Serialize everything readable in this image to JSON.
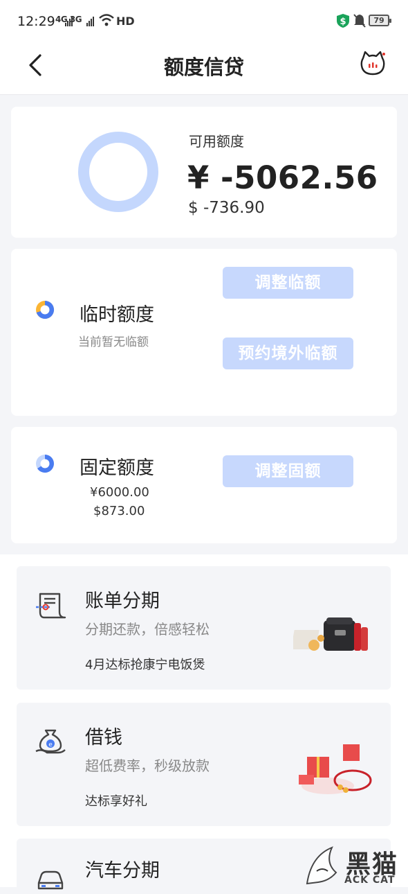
{
  "status_bar": {
    "time": "12:29",
    "network": "4G 3G",
    "hd": "HD",
    "battery": "79"
  },
  "nav": {
    "title": "额度信贷",
    "back_icon": "chevron-left-icon",
    "service_icon": "cat-service-icon"
  },
  "available": {
    "label": "可用额度",
    "cny": "¥ -5062.56",
    "usd": "$ -736.90",
    "ring_color": "#c4d7fd"
  },
  "temporary": {
    "title": "临时额度",
    "subtitle": "当前暂无临额",
    "adjust_button": "调整临额",
    "overseas_button": "预约境外临额"
  },
  "fixed": {
    "title": "固定额度",
    "cny": "¥6000.00",
    "usd": "$873.00",
    "adjust_button": "调整固额"
  },
  "services": [
    {
      "title": "账单分期",
      "desc": "分期还款，倍感轻松",
      "promo": "4月达标抢康宁电饭煲",
      "icon": "bill-installment-icon"
    },
    {
      "title": "借钱",
      "desc": "超低费率，秒级放款",
      "promo": "达标享好礼",
      "icon": "money-bag-icon"
    },
    {
      "title": "汽车分期",
      "icon": "car-icon"
    }
  ],
  "watermark": {
    "text": "黑猫",
    "sub": "ACK CAT"
  },
  "colors": {
    "accent": "#4a7cf0",
    "button_bg": "#c7d8fd",
    "background": "#f4f5f8"
  }
}
